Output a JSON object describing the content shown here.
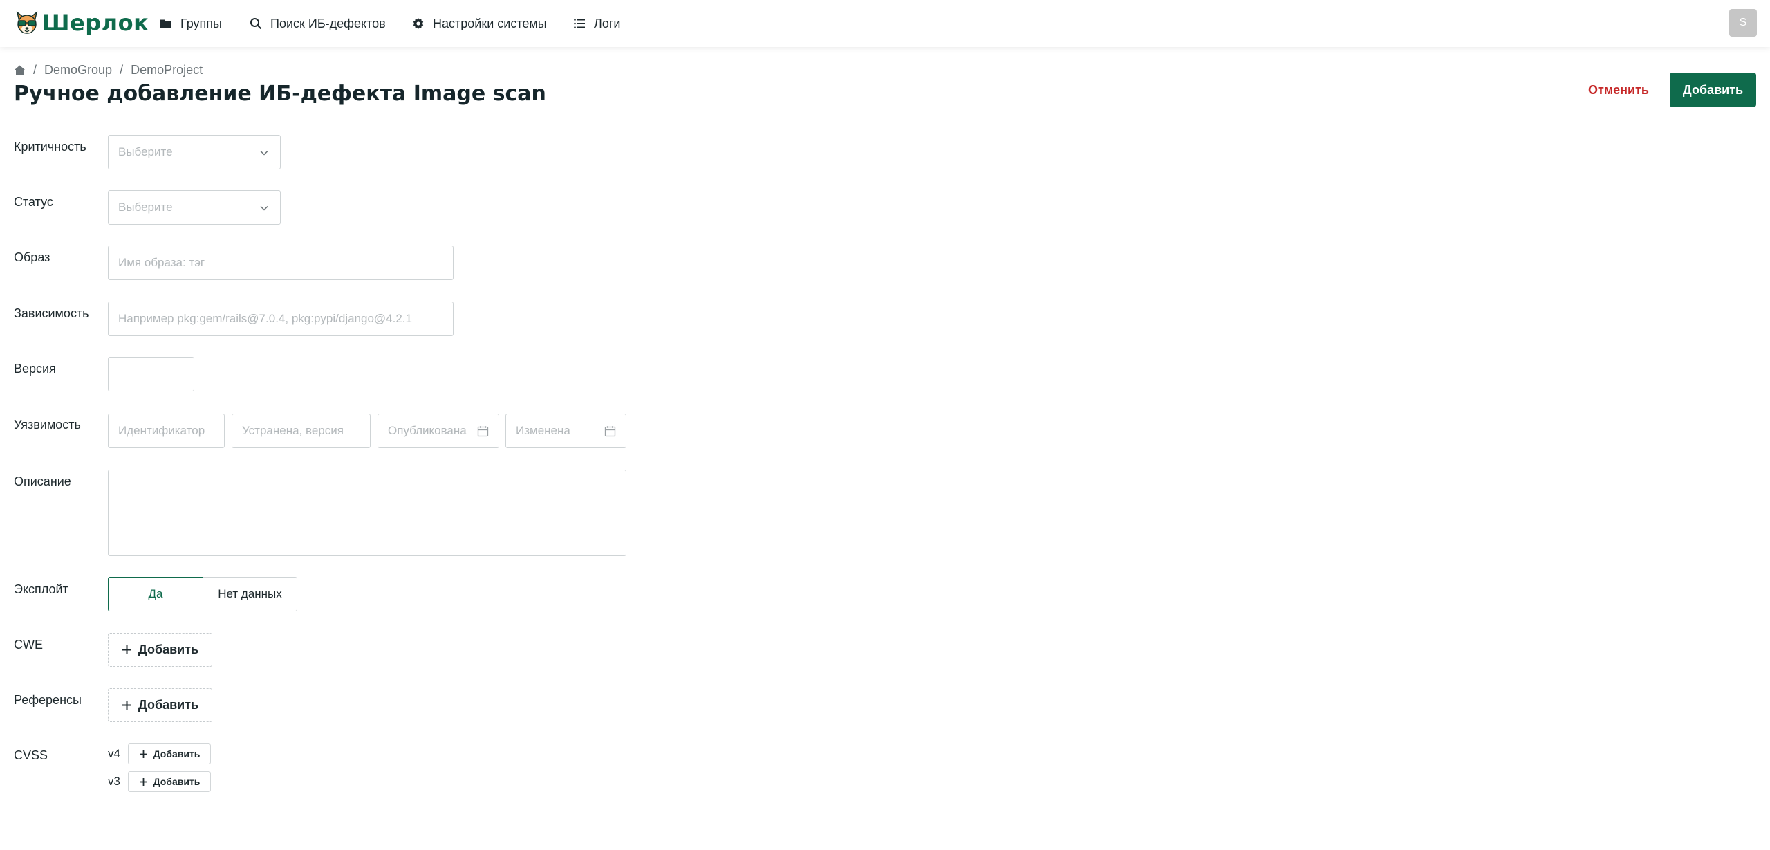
{
  "app": {
    "name": "Шерлок"
  },
  "nav": {
    "groups": "Группы",
    "search": "Поиск ИБ-дефектов",
    "settings": "Настройки системы",
    "logs": "Логи"
  },
  "user": {
    "initial": "S"
  },
  "breadcrumb": {
    "group": "DemoGroup",
    "project": "DemoProject"
  },
  "page": {
    "title": "Ручное добавление ИБ-дефекта Image scan"
  },
  "actions": {
    "cancel": "Отменить",
    "submit": "Добавить"
  },
  "form": {
    "criticality": {
      "label": "Критичность",
      "placeholder": "Выберите"
    },
    "status": {
      "label": "Статус",
      "placeholder": "Выберите"
    },
    "image": {
      "label": "Образ",
      "placeholder": "Имя образа: тэг"
    },
    "dependency": {
      "label": "Зависимость",
      "placeholder": "Например pkg:gem/rails@7.0.4, pkg:pypi/django@4.2.1"
    },
    "version": {
      "label": "Версия",
      "value": ""
    },
    "vulnerability": {
      "label": "Уязвимость",
      "id_placeholder": "Идентификатор",
      "fixed_placeholder": "Устранена, версия",
      "published_placeholder": "Опубликована",
      "modified_placeholder": "Изменена"
    },
    "description": {
      "label": "Описание",
      "value": ""
    },
    "exploit": {
      "label": "Эксплойт",
      "options": [
        "Да",
        "Нет данных"
      ],
      "selected": "Да"
    },
    "cwe": {
      "label": "CWE",
      "add": "Добавить"
    },
    "references": {
      "label": "Референсы",
      "add": "Добавить"
    },
    "cvss": {
      "label": "CVSS",
      "items": [
        {
          "version": "v4",
          "add": "Добавить"
        },
        {
          "version": "v3",
          "add": "Добавить"
        }
      ]
    }
  },
  "colors": {
    "brand": "#0f6b4c",
    "danger": "#c62828",
    "border": "#cfd4d6",
    "placeholder": "#b3b8bb"
  },
  "icons": [
    "dog-logo-icon",
    "folder-icon",
    "search-icon",
    "gear-icon",
    "list-icon",
    "home-icon",
    "chevron-down-icon",
    "calendar-icon",
    "plus-icon"
  ]
}
